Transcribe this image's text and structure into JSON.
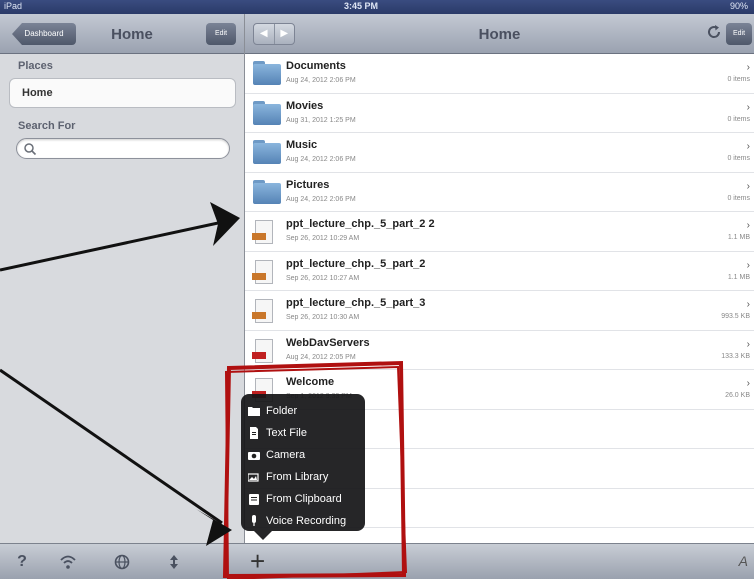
{
  "status_bar": {
    "carrier": "iPad",
    "time": "3:45 PM",
    "battery": "90%"
  },
  "sidebar": {
    "back_label": "Dashboard",
    "title": "Home",
    "edit_label": "Edit",
    "places_header": "Places",
    "places": [
      "Home"
    ],
    "search_header": "Search For",
    "search_placeholder": "",
    "toolbar_icons": [
      "help-icon",
      "wifi-icon",
      "globe-icon",
      "sort-icon"
    ]
  },
  "main": {
    "title": "Home",
    "edit_label": "Edit",
    "back_arrow": "◀",
    "forward_arrow": "▶",
    "files": [
      {
        "name": "Documents",
        "date": "Aug 24, 2012 2:06 PM",
        "size": "0 items",
        "icon": "folder"
      },
      {
        "name": "Movies",
        "date": "Aug 31, 2012 1:25 PM",
        "size": "0 items",
        "icon": "folder"
      },
      {
        "name": "Music",
        "date": "Aug 24, 2012 2:06 PM",
        "size": "0 items",
        "icon": "folder"
      },
      {
        "name": "Pictures",
        "date": "Aug 24, 2012 2:06 PM",
        "size": "0 items",
        "icon": "folder"
      },
      {
        "name": "ppt_lecture_chp._5_part_2 2",
        "date": "Sep 26, 2012 10:29 AM",
        "size": "1.1 MB",
        "icon": "ppt"
      },
      {
        "name": "ppt_lecture_chp._5_part_2",
        "date": "Sep 26, 2012 10:27 AM",
        "size": "1.1 MB",
        "icon": "ppt"
      },
      {
        "name": "ppt_lecture_chp._5_part_3",
        "date": "Sep 26, 2012 10:30 AM",
        "size": "993.5 KB",
        "icon": "ppt"
      },
      {
        "name": "WebDavServers",
        "date": "Aug 24, 2012 2:05 PM",
        "size": "133.3 KB",
        "icon": "pdf"
      },
      {
        "name": "Welcome",
        "date": "Sep 1, 2012 9:33 PM",
        "size": "26.0 KB",
        "icon": "pdf"
      }
    ]
  },
  "add_menu": {
    "items": [
      {
        "label": "Folder",
        "icon": "folder-icon"
      },
      {
        "label": "Text File",
        "icon": "text-file-icon"
      },
      {
        "label": "Camera",
        "icon": "camera-icon"
      },
      {
        "label": "From Library",
        "icon": "photo-library-icon"
      },
      {
        "label": "From Clipboard",
        "icon": "clipboard-icon"
      },
      {
        "label": "Voice Recording",
        "icon": "microphone-icon"
      }
    ]
  },
  "colors": {
    "annotation": "#b01010",
    "popup_bg": "#161618"
  }
}
